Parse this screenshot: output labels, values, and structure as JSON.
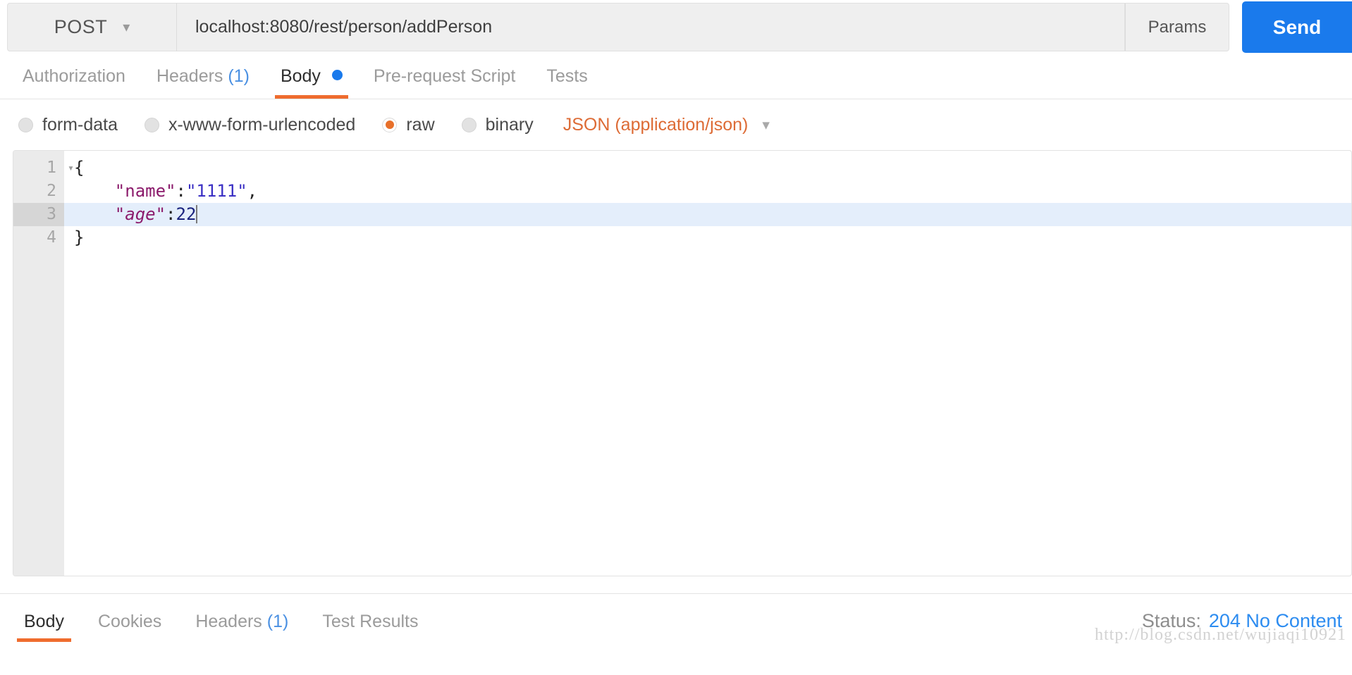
{
  "request_bar": {
    "method": "POST",
    "method_caret_icon": "chevron-down-icon",
    "url": "localhost:8080/rest/person/addPerson",
    "url_placeholder": "Enter request URL",
    "params_label": "Params",
    "send_label": "Send",
    "send_color": "#1a7aec"
  },
  "request_tabs": [
    {
      "label": "Authorization",
      "active": false
    },
    {
      "label": "Headers",
      "count": "(1)",
      "active": false
    },
    {
      "label": "Body",
      "active": true,
      "dot": true
    },
    {
      "label": "Pre-request Script",
      "active": false
    },
    {
      "label": "Tests",
      "active": false
    }
  ],
  "body_types": [
    {
      "label": "form-data",
      "selected": false
    },
    {
      "label": "x-www-form-urlencoded",
      "selected": false
    },
    {
      "label": "raw",
      "selected": true
    },
    {
      "label": "binary",
      "selected": false
    }
  ],
  "content_type": {
    "label": "JSON (application/json)",
    "caret_icon": "chevron-down-icon",
    "color": "#dd6b35"
  },
  "editor": {
    "active_line": 3,
    "lines": [
      {
        "number": "1",
        "foldable": true,
        "tokens": [
          {
            "t": "{",
            "type": "punct"
          }
        ]
      },
      {
        "number": "2",
        "foldable": false,
        "tokens": [
          {
            "t": "    ",
            "type": "punct"
          },
          {
            "t": "\"name\"",
            "type": "key"
          },
          {
            "t": ":",
            "type": "punct"
          },
          {
            "t": "\"1111\"",
            "type": "str"
          },
          {
            "t": ",",
            "type": "punct"
          }
        ]
      },
      {
        "number": "3",
        "foldable": false,
        "tokens": [
          {
            "t": "    ",
            "type": "punct"
          },
          {
            "t": "\"age\"",
            "type": "key-it"
          },
          {
            "t": ":",
            "type": "punct"
          },
          {
            "t": "22",
            "type": "num"
          }
        ]
      },
      {
        "number": "4",
        "foldable": false,
        "tokens": [
          {
            "t": "}",
            "type": "punct"
          }
        ]
      }
    ]
  },
  "response_tabs": [
    {
      "label": "Body",
      "active": true
    },
    {
      "label": "Cookies",
      "active": false
    },
    {
      "label": "Headers",
      "count": "(1)",
      "active": false
    },
    {
      "label": "Test Results",
      "active": false
    }
  ],
  "status": {
    "label": "Status:",
    "value": "204 No Content",
    "color": "#2d8cf0"
  },
  "watermark": "http://blog.csdn.net/wujiaqi10921"
}
